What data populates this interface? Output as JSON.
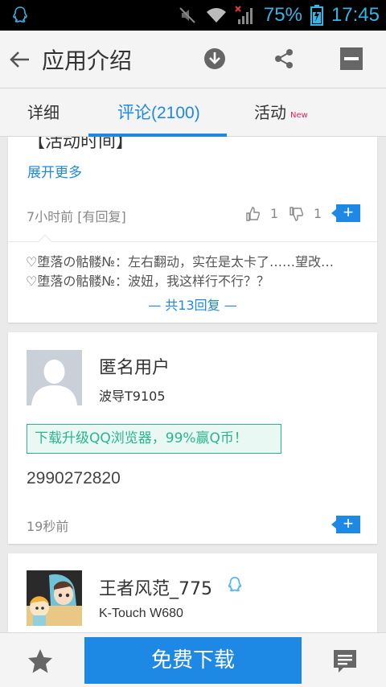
{
  "status_bar": {
    "battery": "75%",
    "time": "17:45"
  },
  "app_bar": {
    "title": "应用介绍"
  },
  "tabs": [
    {
      "label": "详细"
    },
    {
      "label": "评论(2100)"
    },
    {
      "label": "活动",
      "badge": "New"
    }
  ],
  "comment1": {
    "truncated_text": "【活动时间】",
    "expand_label": "展开更多",
    "meta": "7小时前 [有回复]",
    "likes": "1",
    "dislikes": "1",
    "replies": [
      "♡堕落の骷髅№：左右翻动，实在是太卡了……望改…",
      "♡堕落の骷髅№：波妞，我这样行不行？？"
    ],
    "reply_total": "— 共13回复 —"
  },
  "comment2": {
    "username": "匿名用户",
    "device": "波导T9105",
    "promo": "下载升级QQ浏览器，99%赢Q币！",
    "text": "2990272820",
    "time": "19秒前"
  },
  "comment3": {
    "username": "王者风范_775",
    "device": "K-Touch W680"
  },
  "bottom": {
    "download_label": "免费下载"
  },
  "colors": {
    "accent": "#1e88e5",
    "promo_green": "#2bb58f",
    "status_blue": "#33b5e5"
  }
}
